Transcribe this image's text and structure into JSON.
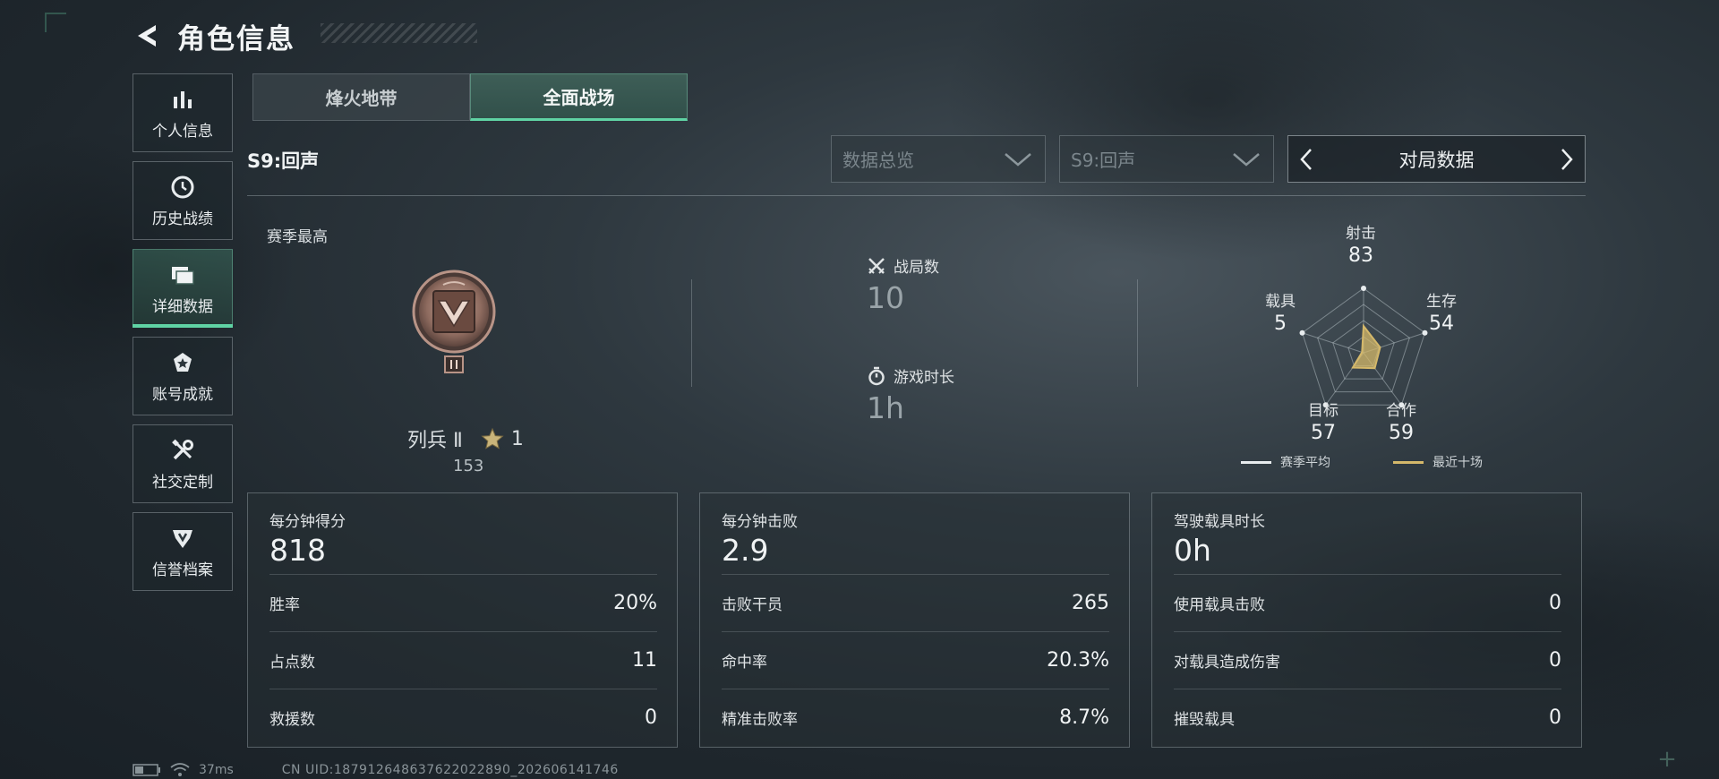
{
  "header": {
    "title": "角色信息"
  },
  "sidebar": {
    "items": [
      {
        "label": "个人信息",
        "icon": "bar-chart-icon"
      },
      {
        "label": "历史战绩",
        "icon": "history-clock-icon"
      },
      {
        "label": "详细数据",
        "icon": "folder-data-icon",
        "active": true
      },
      {
        "label": "账号成就",
        "icon": "achievement-medal-icon"
      },
      {
        "label": "社交定制",
        "icon": "tools-wrench-icon"
      },
      {
        "label": "信誉档案",
        "icon": "shield-emblem-icon"
      }
    ]
  },
  "tabs": [
    {
      "label": "烽火地带",
      "active": false
    },
    {
      "label": "全面战场",
      "active": true
    }
  ],
  "season": {
    "label": "S9:回声"
  },
  "filters": {
    "dropdown1": "数据总览",
    "dropdown2": "S9:回声",
    "stepper": "对局数据"
  },
  "overview": {
    "season_best_label": "赛季最高",
    "rank_name": "列兵 Ⅱ",
    "rank_stars": "1",
    "rank_points": "153",
    "matches_label": "战局数",
    "matches_value": "10",
    "playtime_label": "游戏时长",
    "playtime_value": "1h"
  },
  "radar": {
    "axes": [
      {
        "label": "射击",
        "value": "83"
      },
      {
        "label": "生存",
        "value": "54"
      },
      {
        "label": "合作",
        "value": "59"
      },
      {
        "label": "目标",
        "value": "57"
      },
      {
        "label": "载具",
        "value": "5"
      }
    ],
    "legend": {
      "season_avg": "赛季平均",
      "recent_ten": "最近十场"
    },
    "colors": {
      "season_avg": "#e8ecee",
      "recent_ten": "#d4b86a"
    }
  },
  "cards": [
    {
      "title": "每分钟得分",
      "big": "818",
      "rows": [
        {
          "label": "胜率",
          "value": "20%"
        },
        {
          "label": "占点数",
          "value": "11"
        },
        {
          "label": "救援数",
          "value": "0"
        }
      ]
    },
    {
      "title": "每分钟击败",
      "big": "2.9",
      "rows": [
        {
          "label": "击败干员",
          "value": "265"
        },
        {
          "label": "命中率",
          "value": "20.3%"
        },
        {
          "label": "精准击败率",
          "value": "8.7%"
        }
      ]
    },
    {
      "title": "驾驶载具时长",
      "big": "0h",
      "rows": [
        {
          "label": "使用载具击败",
          "value": "0"
        },
        {
          "label": "对载具造成伤害",
          "value": "0"
        },
        {
          "label": "摧毁载具",
          "value": "0"
        }
      ]
    }
  ],
  "status": {
    "ping": "37ms",
    "uid": "CN UID:18791264863762202289​0_202606141746"
  },
  "colors": {
    "accent": "#5fd3a4"
  }
}
